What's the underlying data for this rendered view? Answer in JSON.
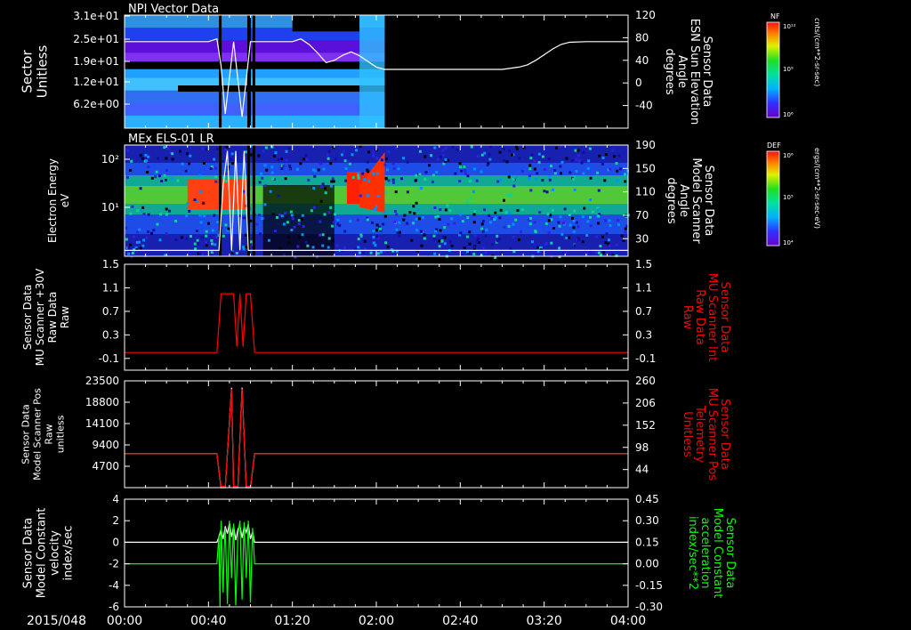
{
  "date_label": "2015/048",
  "colors": {
    "background": "#000000",
    "axis": "#ffffff",
    "red_trace": "#ff0000",
    "green_trace": "#00ff00",
    "white_trace": "#ffffff"
  },
  "x_axis": {
    "range_minutes": [
      0,
      240
    ],
    "ticks": [
      {
        "min": 0,
        "label": "00:00"
      },
      {
        "min": 40,
        "label": "00:40"
      },
      {
        "min": 80,
        "label": "01:20"
      },
      {
        "min": 120,
        "label": "02:00"
      },
      {
        "min": 160,
        "label": "02:40"
      },
      {
        "min": 200,
        "label": "03:20"
      },
      {
        "min": 240,
        "label": "04:00"
      }
    ]
  },
  "chart_data": [
    {
      "type": "heatmap",
      "title": "NPI Vector Data",
      "ylabel": [
        "Sector",
        "Unitless"
      ],
      "yticks": [
        "3.1e+01",
        "2.5e+01",
        "1.9e+01",
        "1.2e+01",
        "6.2e+00"
      ],
      "y2label": [
        "Sensor Data",
        "ESN Sun Elevation",
        "Angle",
        "degrees"
      ],
      "y2ticks": [
        "120",
        "80",
        "40",
        "0",
        "-40"
      ],
      "y2lim": [
        -80,
        120
      ],
      "colorbar": {
        "label": "NF",
        "unit": "cnts/(cm**2-sr-sec)",
        "tick_top": "10¹²",
        "tick_mid": "10⁹",
        "tick_bottom": "10⁶"
      },
      "heatmap_span_minutes": [
        0,
        124
      ],
      "line_series": {
        "name": "ESN Sun Elevation Angle",
        "x": [
          0,
          40,
          44,
          46,
          48,
          52,
          56,
          60,
          62,
          80,
          84,
          88,
          92,
          96,
          100,
          104,
          108,
          112,
          120,
          124,
          140,
          180,
          188,
          192,
          196,
          200,
          204,
          208,
          212,
          220,
          240
        ],
        "y": [
          73,
          73,
          78,
          30,
          -55,
          73,
          -60,
          73,
          73,
          73,
          78,
          68,
          53,
          36,
          40,
          49,
          55,
          48,
          28,
          24,
          24,
          24,
          28,
          32,
          40,
          50,
          60,
          68,
          72,
          73,
          73
        ]
      }
    },
    {
      "type": "heatmap",
      "title": "MEx ELS-01 LR",
      "ylabel": [
        "Electron Energy",
        "eV"
      ],
      "yticks": [
        "10²",
        "10¹"
      ],
      "y2label": [
        "Sensor Data",
        "Model Scanner",
        "Angle",
        "degrees"
      ],
      "y2ticks": [
        "190",
        "150",
        "110",
        "70",
        "30"
      ],
      "y2lim": [
        0,
        190
      ],
      "colorbar": {
        "label": "DEF",
        "unit": "ergs/(cm**2-sr-sec-eV)",
        "tick_top": "10⁶",
        "tick_mid": "10⁵",
        "tick_bottom": "10⁴"
      },
      "line_series": {
        "name": "Model Scanner Angle",
        "x": [
          0,
          45,
          47,
          49,
          51,
          53,
          55,
          57,
          59,
          61,
          240
        ],
        "y": [
          10,
          10,
          120,
          180,
          10,
          180,
          10,
          180,
          10,
          10,
          10
        ]
      }
    },
    {
      "type": "line",
      "ylabel": [
        "Sensor Data",
        "MU Scanner +30V",
        "Raw Data",
        "Raw"
      ],
      "yticks": [
        "1.5",
        "1.1",
        "0.7",
        "0.3",
        "-0.1"
      ],
      "ylim": [
        -0.3,
        1.5
      ],
      "y2label": [
        "Sensor Data",
        "MU Scanner Int",
        "Raw Data",
        "Raw"
      ],
      "y2ticks": [
        "1.5",
        "1.1",
        "0.7",
        "0.3",
        "-0.1"
      ],
      "series": [
        {
          "name": "MU Scanner Int Raw Data",
          "color": "#ff0000",
          "x": [
            0,
            44,
            46,
            52,
            53.5,
            55,
            56.5,
            58,
            60,
            62,
            240
          ],
          "y": [
            0,
            0,
            1,
            1,
            0.1,
            1,
            0.1,
            1,
            1,
            0,
            0
          ]
        }
      ]
    },
    {
      "type": "line",
      "ylabel": [
        "Sensor Data",
        "Model Scanner Pos",
        "Raw",
        "unitless"
      ],
      "yticks": [
        "23500",
        "18800",
        "14100",
        "9400",
        "4700"
      ],
      "ylim": [
        0,
        23500
      ],
      "y2label": [
        "Sensor Data",
        "MU Scanner Pos",
        "Telemetry",
        "Unitless"
      ],
      "y2ticks": [
        "260",
        "206",
        "152",
        "98",
        "44"
      ],
      "y2lim": [
        0,
        260
      ],
      "series": [
        {
          "name": "Model Scanner Pos Raw",
          "color": "#ffffff",
          "axis": "left",
          "x": [
            0,
            44,
            46,
            48,
            51,
            52,
            54,
            56,
            58,
            60,
            62,
            240
          ],
          "y": [
            7500,
            7500,
            0,
            0,
            22000,
            0,
            0,
            22000,
            0,
            0,
            7500,
            7500
          ]
        },
        {
          "name": "MU Scanner Pos Telemetry",
          "color": "#ff0000",
          "axis": "right",
          "x": [
            0,
            44,
            46,
            48,
            51,
            52,
            54,
            56,
            58,
            60,
            62,
            240
          ],
          "y": [
            83,
            83,
            3,
            3,
            240,
            3,
            3,
            240,
            3,
            3,
            83,
            83
          ]
        }
      ]
    },
    {
      "type": "line",
      "ylabel": [
        "Sensor Data",
        "Model Constant",
        "velocity",
        "index/sec"
      ],
      "yticks": [
        "4",
        "2",
        "0",
        "-2",
        "-4",
        "-6"
      ],
      "ylim": [
        -6,
        4
      ],
      "y2label": [
        "Sensor Data",
        "Model Constant",
        "acceleration",
        "index/sec**2"
      ],
      "y2ticks": [
        "0.45",
        "0.30",
        "0.15",
        "0.00",
        "-0.15",
        "-0.30"
      ],
      "y2lim": [
        -0.3,
        0.45
      ],
      "series": [
        {
          "name": "Model Constant velocity",
          "color": "#ffffff",
          "axis": "left",
          "x": [
            0,
            44,
            45,
            46,
            47,
            48,
            49,
            50,
            51,
            52,
            53,
            54,
            55,
            56,
            57,
            58,
            59,
            60,
            61,
            62,
            240
          ],
          "y": [
            0,
            0,
            0.5,
            1.2,
            0.3,
            1.5,
            0.8,
            1.8,
            0.5,
            1.5,
            0.2,
            1.2,
            1.6,
            0.4,
            1.5,
            0.9,
            1.7,
            0.3,
            1.0,
            0,
            0
          ]
        },
        {
          "name": "Model Constant acceleration",
          "color": "#00ff00",
          "axis": "right",
          "x": [
            0,
            44,
            45,
            45.5,
            46,
            47,
            47.5,
            48,
            49,
            50,
            51,
            52,
            53,
            54,
            55,
            56,
            57,
            58,
            59,
            60,
            61,
            62,
            240
          ],
          "y": [
            0,
            0,
            0.2,
            -0.3,
            0.3,
            -0.2,
            0.1,
            0.25,
            -0.28,
            0.3,
            -0.1,
            0.28,
            -0.29,
            0.2,
            0.3,
            -0.25,
            0.29,
            -0.1,
            0.3,
            -0.27,
            0.25,
            0,
            0
          ]
        }
      ]
    }
  ]
}
